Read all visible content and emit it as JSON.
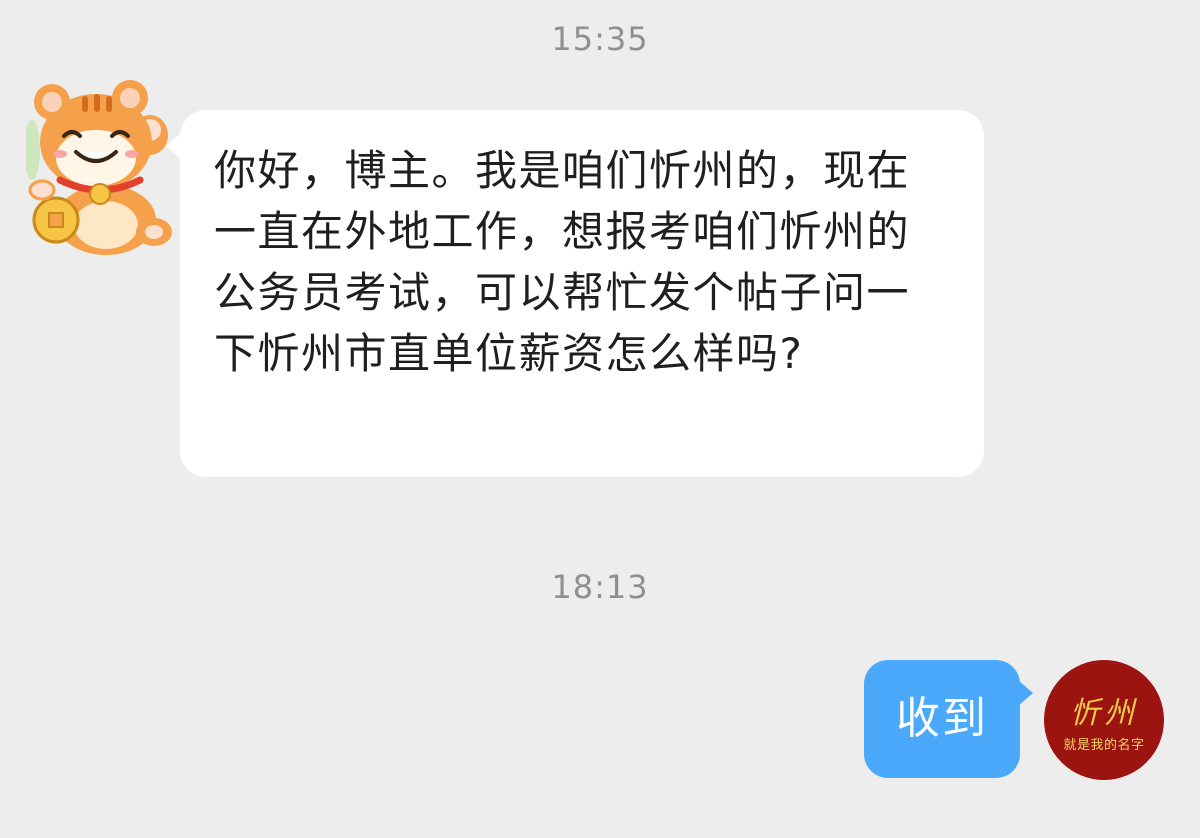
{
  "chat": {
    "timestamps": [
      "15:35",
      "18:13"
    ],
    "incoming": {
      "text": "你好，博主。我是咱们忻州的，现在一直在外地工作，想报考咱们忻州的公务员考试，可以帮忙发个帖子问一下忻州市直单位薪资怎么样吗?"
    },
    "outgoing": {
      "text": "收到"
    },
    "self_avatar": {
      "title": "忻州",
      "subtitle": "就是我的名字"
    }
  },
  "colors": {
    "background": "#ededed",
    "incoming_bubble": "#ffffff",
    "outgoing_bubble": "#4aa9fb",
    "self_avatar_bg": "#9b140f",
    "self_avatar_text": "#f2c84b",
    "timestamp_text": "#8f8f8f"
  },
  "icons": {
    "sender_avatar": "tiger-avatar-icon"
  }
}
